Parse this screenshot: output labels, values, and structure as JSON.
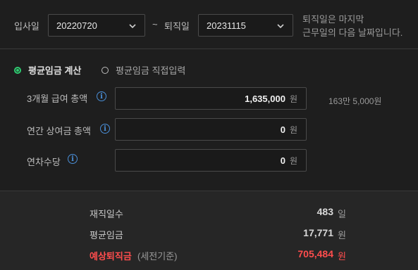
{
  "dates": {
    "start_label": "입사일",
    "start_value": "20220720",
    "separator": "~",
    "end_label": "퇴직일",
    "end_value": "20231115",
    "note_line1": "퇴직일은 마지막",
    "note_line2": "근무일의 다음 날짜입니다."
  },
  "mode": {
    "option_calc": "평균임금 계산",
    "option_manual": "평균임금 직접입력",
    "selected": "option_calc",
    "accent": "#2ecc71"
  },
  "fields": {
    "salary_3m": {
      "label": "3개월 급여 총액",
      "value": "1,635,000",
      "unit": "원",
      "hint": "163만 5,000원"
    },
    "bonus_annual": {
      "label": "연간 상여금 총액",
      "value": "0",
      "unit": "원"
    },
    "leave_allowance": {
      "label": "연차수당",
      "value": "0",
      "unit": "원"
    }
  },
  "summary": {
    "days_label": "재직일수",
    "days_value": "483",
    "days_unit": "일",
    "avg_label": "평균임금",
    "avg_value": "17,771",
    "avg_unit": "원",
    "severance_label": "예상퇴직금",
    "severance_note": "(세전기준)",
    "severance_value": "705,484",
    "severance_unit": "원",
    "highlight": "#ff4d4d"
  },
  "icons": {
    "info": "i"
  }
}
